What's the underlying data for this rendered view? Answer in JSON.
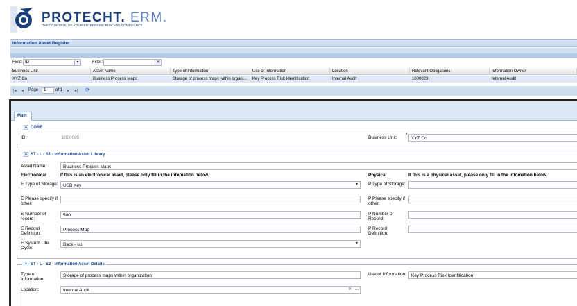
{
  "brand": {
    "name": "PROTECHT.",
    "suffix": "ERM.",
    "tagline": "TAKE CONTROL OF YOUR ENTERPRISE RISK AND COMPLIANCE"
  },
  "register": {
    "title": "Information Asset Register",
    "filter": {
      "field_label": "Field:",
      "field_value": "ID",
      "filter_label": "Filter:",
      "filter_value": ""
    },
    "columns": [
      "Business Unit",
      "Asset Name",
      "Type of Information",
      "Use of Information",
      "Location",
      "Relevant Obligations",
      "Information Owner"
    ],
    "rows": [
      [
        "XYZ Co",
        "Business Process Maps",
        "Storage of process maps within organi...",
        "Key Process Risk Idenfitication",
        "Internal Audit",
        "1000023",
        "Internal Audit"
      ]
    ],
    "paging": {
      "page_label": "Page",
      "page_value": "1",
      "of_label": "of 1"
    }
  },
  "tabs": [
    {
      "label": "Main",
      "active": true
    }
  ],
  "form": {
    "core": {
      "legend": "CORE",
      "id_label": "ID:",
      "id_value": "1000085",
      "bu_label": "Business Unit:",
      "bu_value": "XYZ Co"
    },
    "library": {
      "legend": "ST - L - S1 - Information Asset Library",
      "asset_name_label": "Asset Name:",
      "asset_name_value": "Business Process Maps",
      "electronical_heading": "Electronical",
      "electronical_note": "If this is an electronical asset, please only fill in the infomation below.",
      "physical_heading": "Physical",
      "physical_note": "If this is a physical asset, please only fill in the infomation below.",
      "e_type_label": "E Type of Storage:",
      "e_type_value": "USB Key",
      "e_specify_label": "E Please specify if other:",
      "e_specify_value": "",
      "e_number_label": "E Number of record:",
      "e_number_value": "500",
      "e_record_def_label": "E Record Definition:",
      "e_record_def_value": "Process Map",
      "e_lifecycle_label": "E System Life Cycle:",
      "e_lifecycle_value": "Back - up",
      "p_type_label": "P Type of Storage:",
      "p_type_value": "",
      "p_specify_label": "P Please specify if other:",
      "p_specify_value": "",
      "p_number_label": "P Number of Record:",
      "p_number_value": "",
      "p_record_def_label": "P Record Definition:",
      "p_record_def_value": ""
    },
    "details": {
      "legend": "ST - L - S2 - Information Asset Details",
      "type_label": "Type of Information:",
      "type_value": "Storage of process maps within organization",
      "use_label": "Use of Information:",
      "use_value": "Key Process Risk Idenfitication",
      "location_label": "Location:",
      "location_value": "Internal Audit"
    }
  },
  "colors": {
    "brand": "#1c3f7a",
    "header_blue": "#15428b",
    "panel_bg": "#dfe8f6",
    "selected_row": "#dfe8f6"
  }
}
